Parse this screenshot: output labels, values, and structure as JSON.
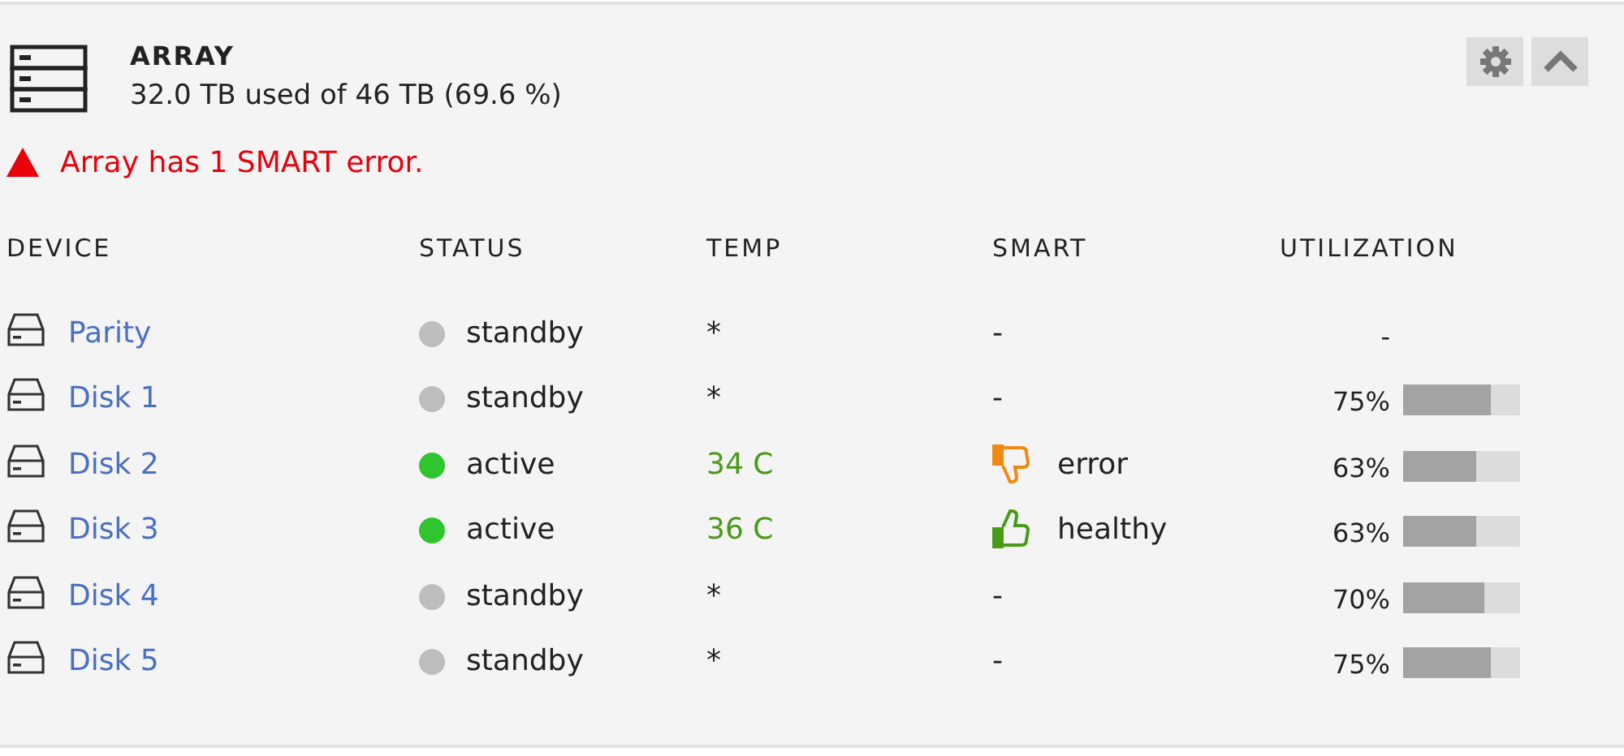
{
  "header": {
    "title": "ARRAY",
    "usage": "32.0 TB used of 46 TB (69.6 %)",
    "alert": "Array has 1 SMART error."
  },
  "toolbar": [
    {
      "kind": "settings"
    },
    {
      "kind": "collapse"
    }
  ],
  "table": {
    "columns": [
      "DEVICE",
      "STATUS",
      "TEMP",
      "SMART",
      "UTILIZATION"
    ],
    "rows": [
      {
        "device": "Parity",
        "active": false,
        "status": "standby",
        "temp": "*",
        "temp_ok": false,
        "smart": {
          "kind": "none",
          "text": "-"
        },
        "utilization": {
          "text": "-"
        }
      },
      {
        "device": "Disk 1",
        "active": false,
        "status": "standby",
        "temp": "*",
        "temp_ok": false,
        "smart": {
          "kind": "none",
          "text": "-"
        },
        "utilization": {
          "text": "75%",
          "level": 0.75
        }
      },
      {
        "device": "Disk 2",
        "active": true,
        "status": "active",
        "temp": "34 C",
        "temp_ok": true,
        "smart": {
          "kind": "error",
          "text": "error"
        },
        "utilization": {
          "text": "63%",
          "level": 0.63
        }
      },
      {
        "device": "Disk 3",
        "active": true,
        "status": "active",
        "temp": "36 C",
        "temp_ok": true,
        "smart": {
          "kind": "healthy",
          "text": "healthy"
        },
        "utilization": {
          "text": "63%",
          "level": 0.63
        }
      },
      {
        "device": "Disk 4",
        "active": false,
        "status": "standby",
        "temp": "*",
        "temp_ok": false,
        "smart": {
          "kind": "none",
          "text": "-"
        },
        "utilization": {
          "text": "70%",
          "level": 0.7
        }
      },
      {
        "device": "Disk 5",
        "active": false,
        "status": "standby",
        "temp": "*",
        "temp_ok": false,
        "smart": {
          "kind": "none",
          "text": "-"
        },
        "utilization": {
          "text": "75%",
          "level": 0.75
        }
      }
    ]
  }
}
